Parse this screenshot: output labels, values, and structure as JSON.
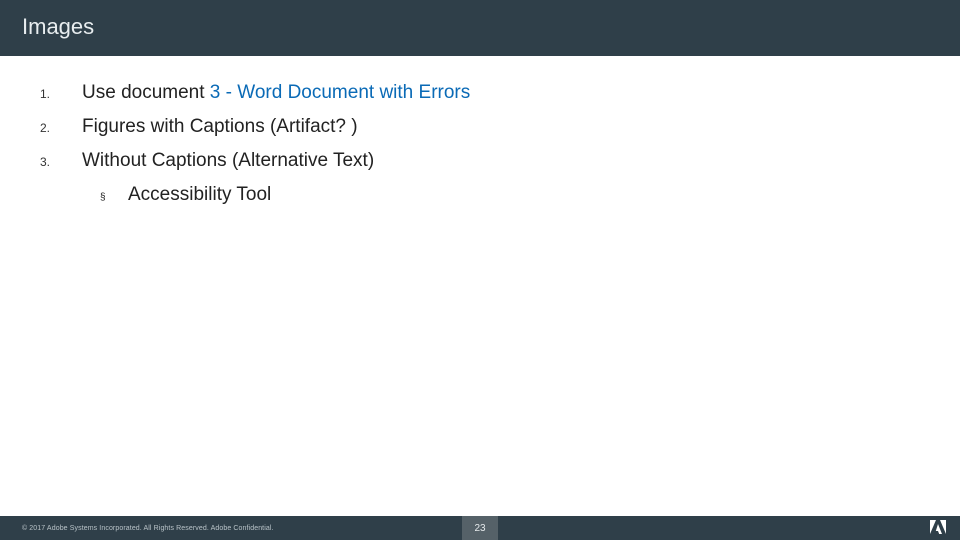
{
  "header": {
    "title": "Images"
  },
  "list": {
    "items": [
      {
        "num": "1.",
        "text_prefix": "Use document ",
        "link": "3 - Word Document with Errors"
      },
      {
        "num": "2.",
        "text": "Figures with Captions (Artifact? )"
      },
      {
        "num": "3.",
        "text": "Without Captions (Alternative Text)"
      }
    ],
    "subitem": {
      "bullet": "§",
      "text": "Accessibility Tool"
    }
  },
  "footer": {
    "copyright": "© 2017 Adobe Systems Incorporated.  All Rights Reserved.  Adobe Confidential.",
    "page": "23"
  }
}
